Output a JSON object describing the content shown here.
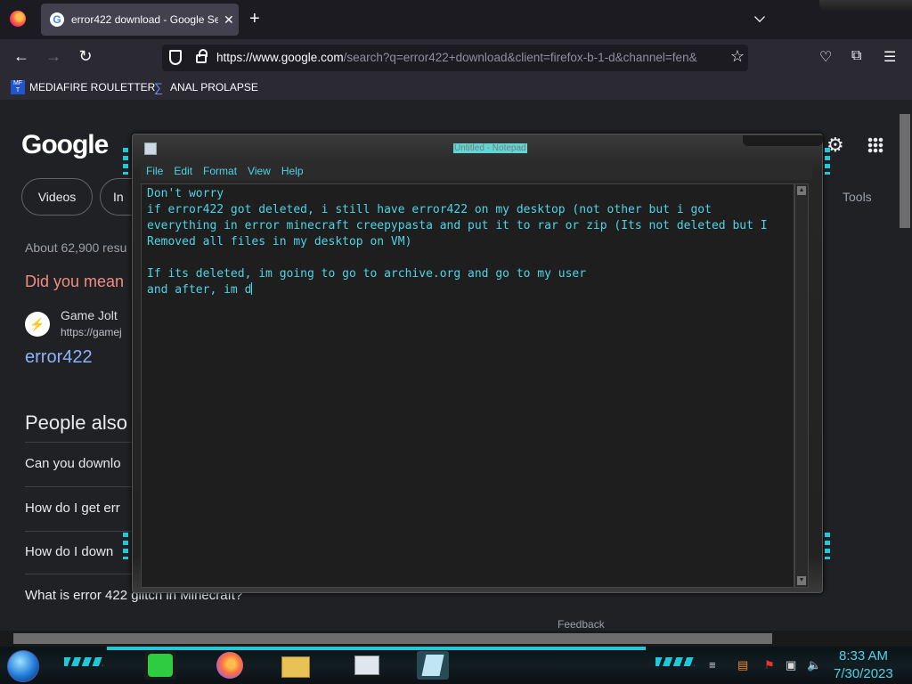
{
  "browser": {
    "tab": {
      "title": "error422 download - Google Se",
      "favicon": "G"
    },
    "url": {
      "domain": "https://www.google.com",
      "rest": "/search?q=error422+download&client=firefox-b-1-d&channel=fen&"
    },
    "bookmarks": [
      {
        "label": "MEDIAFIRE ROULETTER",
        "icon": "MF\nT"
      },
      {
        "label": "ANAL PROLAPSE",
        "icon": "∑"
      }
    ]
  },
  "google": {
    "logo": "Google",
    "chips": {
      "videos": "Videos",
      "images_partial": "In"
    },
    "tools": "Tools",
    "results_count": "About 62,900 resu",
    "did_you_mean": "Did you mean",
    "result": {
      "site": "Game Jolt",
      "url": "https://gamej",
      "title": "error422"
    },
    "paa_heading": "People also",
    "paa_questions": [
      "Can you downlo",
      "How do I get err",
      "How do I down",
      "What is error 422 glitch in Minecraft?"
    ],
    "feedback": "Feedback"
  },
  "notepad": {
    "title": "Untitled - Notepad",
    "menus": [
      "File",
      "Edit",
      "Format",
      "View",
      "Help"
    ],
    "text": "Don't worry\nif error422 got deleted, i still have error422 on my desktop (not other but i got\neverything in error minecraft creepypasta and put it to rar or zip (Its not deleted but I\nRemoved all files in my desktop on VM)\n\nIf its deleted, im going to go to archive.org and go to my user\nand after, im d"
  },
  "taskbar": {
    "time": "8:33 AM",
    "date": "7/30/2023",
    "apps": [
      "notes-app-icon",
      "firefox-icon",
      "file-explorer-icon",
      "task-manager-icon",
      "notepad-icon"
    ]
  },
  "colors": {
    "accent": "#21c8d8",
    "text_cyan": "#4ed4e6",
    "link": "#8ab4f8",
    "did_you_mean": "#f28b82"
  }
}
